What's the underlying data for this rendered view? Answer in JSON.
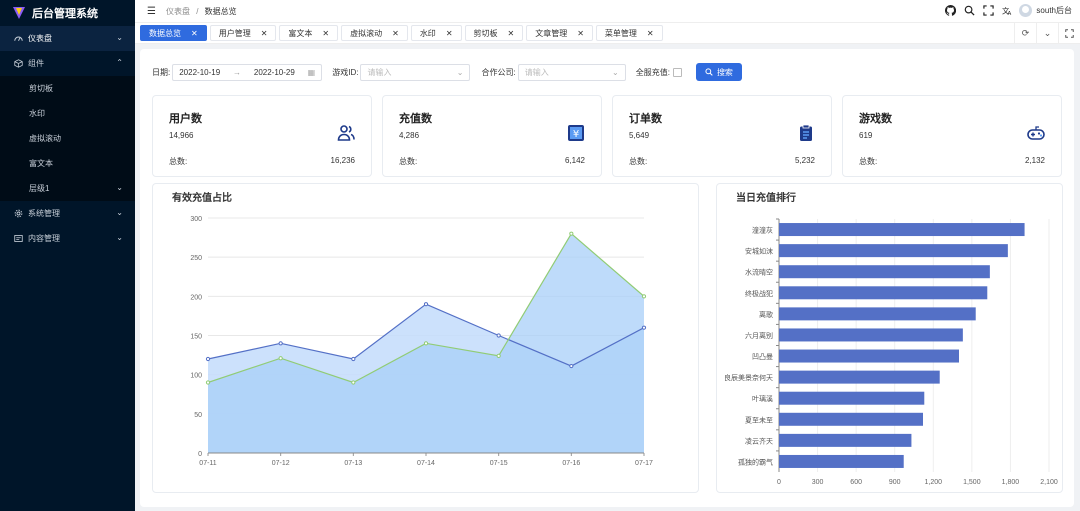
{
  "app": {
    "title": "后台管理系统"
  },
  "sidebar": {
    "items": [
      {
        "label": "仪表盘",
        "icon": "dashboard-icon",
        "expandable": true,
        "active": true
      },
      {
        "label": "组件",
        "icon": "cube-icon",
        "expandable": true,
        "expanded": true
      },
      {
        "label": "剪切板",
        "sub": true
      },
      {
        "label": "水印",
        "sub": true
      },
      {
        "label": "虚拟滚动",
        "sub": true
      },
      {
        "label": "富文本",
        "sub": true
      },
      {
        "label": "层级1",
        "sub": true,
        "expandable": true
      },
      {
        "label": "系统管理",
        "icon": "gear-icon",
        "expandable": true
      },
      {
        "label": "内容管理",
        "icon": "folder-icon",
        "expandable": true
      }
    ]
  },
  "header": {
    "breadcrumb": [
      "仪表盘",
      "数据总览"
    ],
    "separator": "/",
    "user": "south后台",
    "icons": [
      "github-icon",
      "search-icon",
      "fullscreen-icon",
      "language-icon",
      "theme-toggle-icon"
    ]
  },
  "tabs": [
    "数据总览",
    "用户管理",
    "富文本",
    "虚拟滚动",
    "水印",
    "剪切板",
    "文章管理",
    "菜单管理"
  ],
  "filters": {
    "date_label": "日期:",
    "date_start": "2022-10-19",
    "date_sep": "→",
    "date_end": "2022-10-29",
    "game_label": "游戏ID:",
    "game_placeholder": "请输入",
    "partner_label": "合作公司:",
    "partner_placeholder": "请输入",
    "recharge_label": "全服充值:",
    "search_label": "搜索"
  },
  "cards": [
    {
      "title": "用户数",
      "value": "14,966",
      "total_label": "总数:",
      "total": "16,236",
      "icon": "users-icon"
    },
    {
      "title": "充值数",
      "value": "4,286",
      "total_label": "总数:",
      "total": "6,142",
      "icon": "yen-icon"
    },
    {
      "title": "订单数",
      "value": "5,649",
      "total_label": "总数:",
      "total": "5,232",
      "icon": "clipboard-icon"
    },
    {
      "title": "游戏数",
      "value": "619",
      "total_label": "总数:",
      "total": "2,132",
      "icon": "gamepad-icon"
    }
  ],
  "colors": {
    "primary": "#2f6bdf",
    "sidebar_bg": "#001529",
    "bar": "#5470c6",
    "line_blue": "#5470c6",
    "line_green": "#91cc75",
    "area_blue": "#a8cff8"
  },
  "chart_data": [
    {
      "type": "area",
      "title": "有效充值占比",
      "categories": [
        "07-11",
        "07-12",
        "07-13",
        "07-14",
        "07-15",
        "07-16",
        "07-17"
      ],
      "series": [
        {
          "values": [
            120,
            140,
            120,
            190,
            150,
            111,
            160
          ]
        },
        {
          "values": [
            90,
            121,
            90,
            140,
            124,
            280,
            200
          ]
        }
      ],
      "ylim": [
        0,
        300
      ],
      "yticks": [
        0,
        50,
        100,
        150,
        200,
        250,
        300
      ],
      "grid": true
    },
    {
      "type": "bar",
      "title": "当日充值排行",
      "orientation": "horizontal",
      "categories": [
        "潼潼灰",
        "安城如沫",
        "水流晴空",
        "终极战犯",
        "离歌",
        "六月离别",
        "凹凸曼",
        "良辰美景奈何天",
        "叶璃溪",
        "夏至未至",
        "凌云齐天",
        "孤独的霸气"
      ],
      "values": [
        1910,
        1780,
        1640,
        1620,
        1530,
        1430,
        1400,
        1250,
        1130,
        1120,
        1030,
        970
      ],
      "xlim": [
        0,
        2100
      ],
      "xticks": [
        0,
        300,
        600,
        900,
        1200,
        1500,
        1800,
        2100
      ],
      "xtick_labels": [
        "0",
        "300",
        "600",
        "900",
        "1,200",
        "1,500",
        "1,800",
        "2,100"
      ],
      "grid": true
    }
  ]
}
